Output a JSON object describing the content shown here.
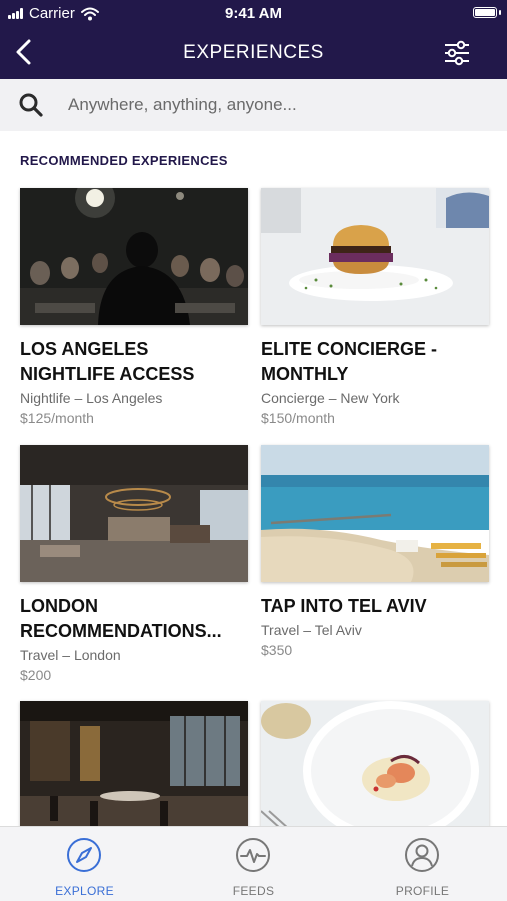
{
  "status_bar": {
    "carrier": "Carrier",
    "time": "9:41 AM"
  },
  "nav": {
    "title": "EXPERIENCES"
  },
  "search": {
    "placeholder": "Anywhere, anything, anyone..."
  },
  "section": {
    "title": "RECOMMENDED EXPERIENCES"
  },
  "cards": [
    {
      "title": "LOS ANGELES NIGHTLIFE ACCESS",
      "meta": "Nightlife – Los Angeles",
      "price": "$125/month"
    },
    {
      "title": "ELITE CONCIERGE - MONTHLY",
      "meta": "Concierge – New York",
      "price": "$150/month"
    },
    {
      "title": "LONDON RECOMMENDATIONS...",
      "meta": "Travel – London",
      "price": "$200"
    },
    {
      "title": "TAP INTO TEL AVIV",
      "meta": "Travel – Tel Aviv",
      "price": "$350"
    }
  ],
  "tabs": [
    {
      "label": "EXPLORE",
      "icon": "compass-icon"
    },
    {
      "label": "FEEDS",
      "icon": "pulse-icon"
    },
    {
      "label": "PROFILE",
      "icon": "user-icon"
    }
  ],
  "colors": {
    "header": "#22184a",
    "accent": "#3a6fd6"
  }
}
